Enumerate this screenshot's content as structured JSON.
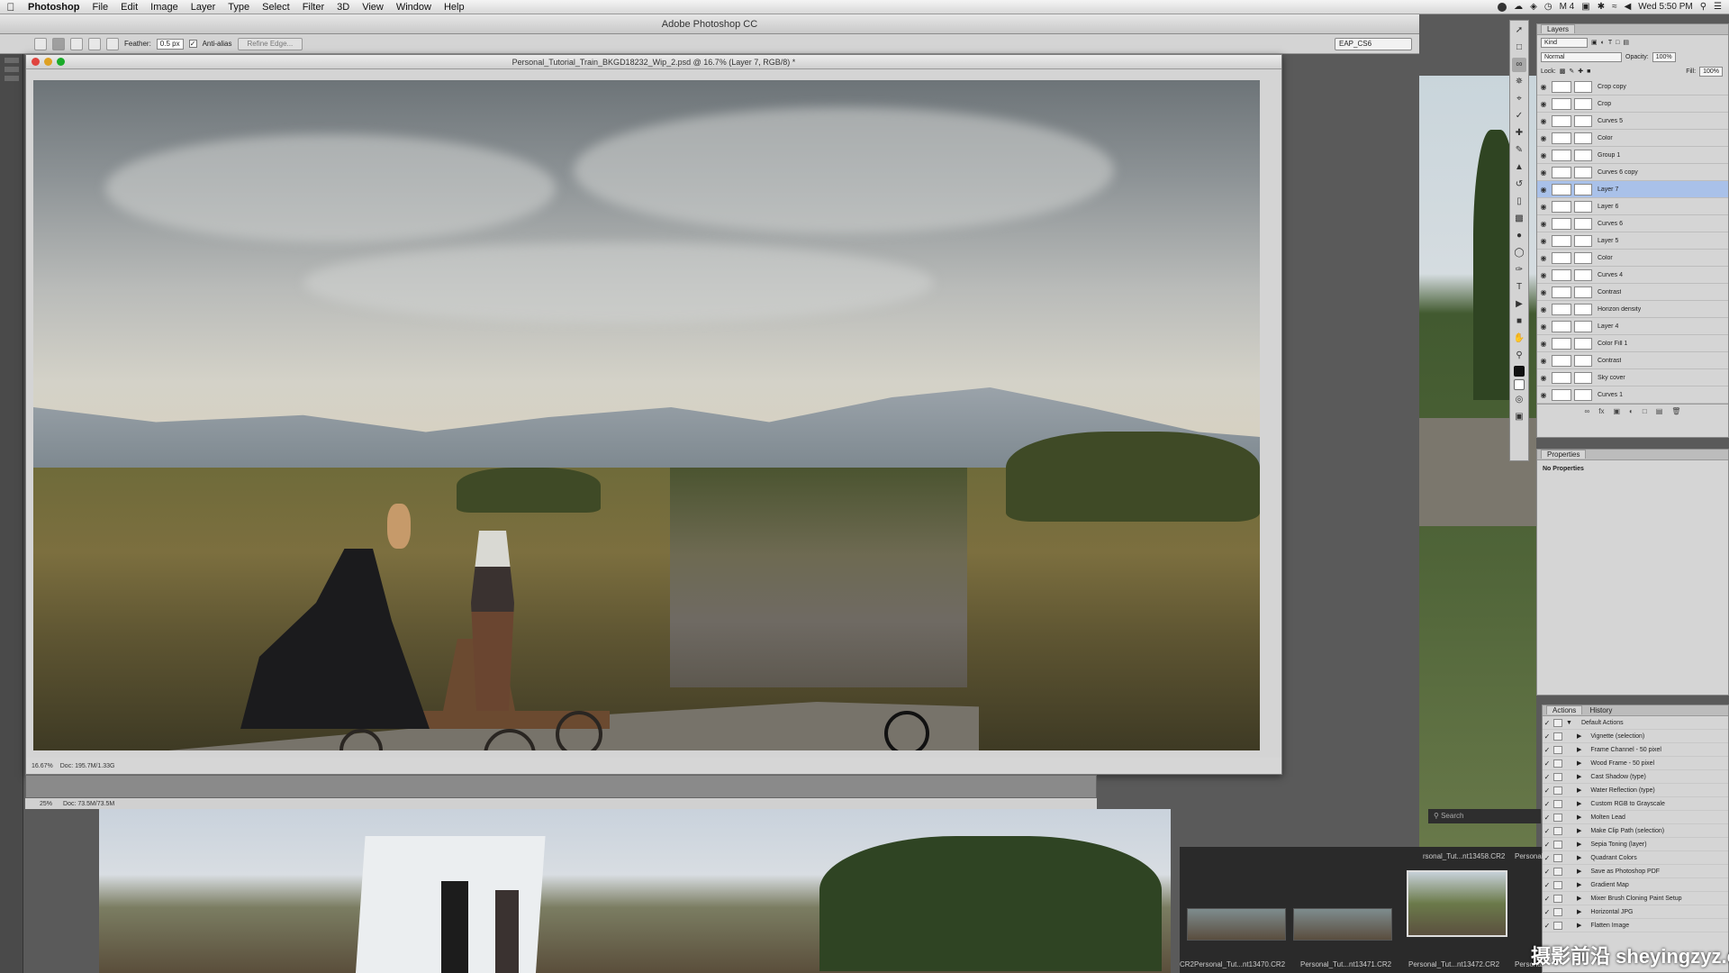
{
  "menubar": {
    "app_name": "Photoshop",
    "items": [
      "File",
      "Edit",
      "Image",
      "Layer",
      "Type",
      "Select",
      "Filter",
      "3D",
      "View",
      "Window",
      "Help"
    ],
    "status_badge": "M 4",
    "clock": "Wed 5:50 PM"
  },
  "app_title": "Adobe Photoshop CC",
  "options_bar": {
    "feather_label": "Feather:",
    "feather_value": "0.5 px",
    "antialias_label": "Anti-alias",
    "refine_edge_label": "Refine Edge...",
    "workspace": "EAP_CS6"
  },
  "document": {
    "title": "Personal_Tutorial_Train_BKGD18232_Wip_2.psd @ 16.7% (Layer 7, RGB/8) *",
    "zoom": "16.67%",
    "doc_info": "Doc: 195.7M/1.33G"
  },
  "document2": {
    "zoom": "25%",
    "doc_info": "Doc: 73.5M/73.5M"
  },
  "layers_panel": {
    "tab": "Layers",
    "kind_label": "Kind",
    "blend_mode": "Normal",
    "opacity_label": "Opacity:",
    "opacity_value": "100%",
    "lock_label": "Lock:",
    "fill_label": "Fill:",
    "fill_value": "100%",
    "layers": [
      {
        "name": "Crop copy",
        "selected": false
      },
      {
        "name": "Crop",
        "selected": false
      },
      {
        "name": "Curves 5",
        "selected": false
      },
      {
        "name": "Color",
        "selected": false
      },
      {
        "name": "Group 1",
        "selected": false
      },
      {
        "name": "Curves 6 copy",
        "selected": false
      },
      {
        "name": "Layer 7",
        "selected": true
      },
      {
        "name": "Layer 6",
        "selected": false
      },
      {
        "name": "Curves 6",
        "selected": false
      },
      {
        "name": "Layer 5",
        "selected": false
      },
      {
        "name": "Color",
        "selected": false
      },
      {
        "name": "Curves 4",
        "selected": false
      },
      {
        "name": "Contrast",
        "selected": false
      },
      {
        "name": "Horizon density",
        "selected": false
      },
      {
        "name": "Layer 4",
        "selected": false
      },
      {
        "name": "Color Fill 1",
        "selected": false
      },
      {
        "name": "Contrast",
        "selected": false
      },
      {
        "name": "Sky cover",
        "selected": false
      },
      {
        "name": "Curves 1",
        "selected": false
      }
    ]
  },
  "properties_panel": {
    "tab": "Properties",
    "text": "No Properties"
  },
  "actions_panel": {
    "tabs": [
      "Actions",
      "History"
    ],
    "items": [
      "Default Actions",
      "Vignette (selection)",
      "Frame Channel - 50 pixel",
      "Wood Frame - 50 pixel",
      "Cast Shadow (type)",
      "Water Reflection (type)",
      "Custom RGB to Grayscale",
      "Molten Lead",
      "Make Clip Path (selection)",
      "Sepia Toning (layer)",
      "Quadrant Colors",
      "Save as Photoshop PDF",
      "Gradient Map",
      "Mixer Brush Cloning Paint Setup",
      "Horizontal JPG",
      "Flatten Image"
    ]
  },
  "bridge": {
    "search_placeholder": "Search",
    "top_label": "rsonal_Tut...nt13458.CR2",
    "top_label2": "Personal",
    "labels": [
      "CR2",
      "Personal_Tut...nt13470.CR2",
      "Personal_Tut...nt13471.CR2",
      "Personal_Tut...nt13472.CR2",
      "Personal_Tut..."
    ]
  },
  "watermark": "摄影前沿 sheyingzyz.com"
}
